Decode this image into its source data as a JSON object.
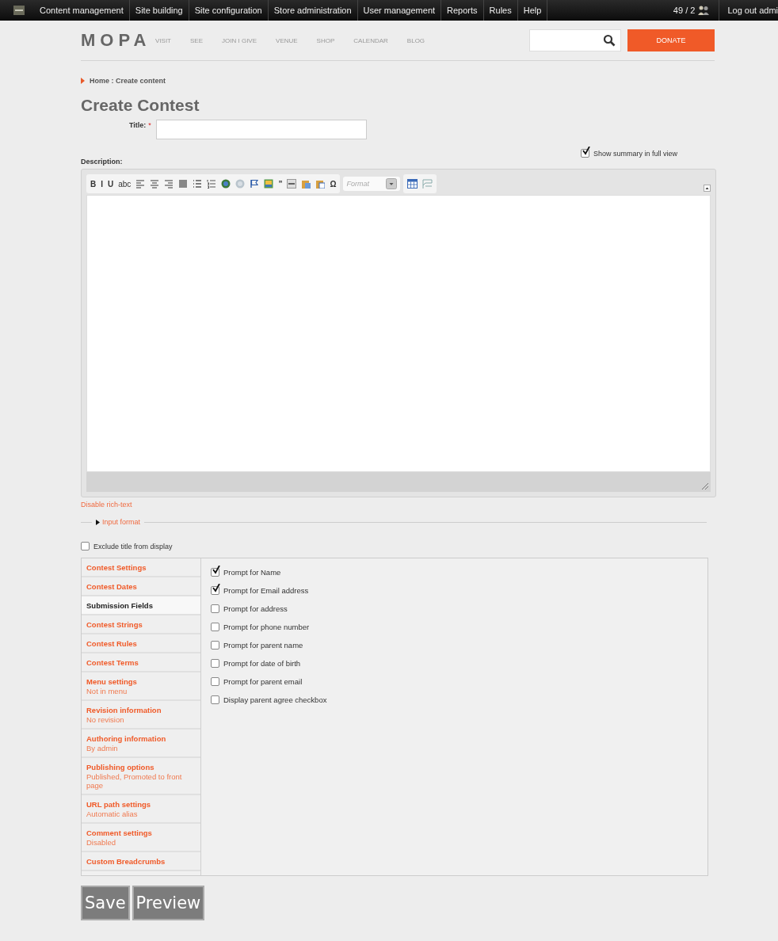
{
  "admin_bar": {
    "menu": [
      "Content management",
      "Site building",
      "Site configuration",
      "Store administration",
      "User management",
      "Reports",
      "Rules",
      "Help"
    ],
    "users_count": "49 / 2",
    "logout": "Log out admi"
  },
  "header": {
    "logo": "MOPA",
    "nav": [
      "VISIT",
      "SEE",
      "JOIN I GIVE",
      "VENUE",
      "SHOP",
      "CALENDAR",
      "BLOG"
    ],
    "donate": "DONATE"
  },
  "breadcrumb": "Home : Create content",
  "page_title": "Create Contest",
  "title_field": {
    "label": "Title:",
    "required_mark": "*"
  },
  "show_summary": {
    "label": "Show summary in full view",
    "checked": true
  },
  "description_label": "Description:",
  "toolbar": [
    {
      "kind": "text",
      "label": "B"
    },
    {
      "kind": "text",
      "label": "I"
    },
    {
      "kind": "text",
      "label": "U"
    },
    {
      "kind": "text",
      "label": "abc"
    },
    {
      "kind": "align-left"
    },
    {
      "kind": "align-center"
    },
    {
      "kind": "align-right"
    },
    {
      "kind": "justify"
    },
    {
      "kind": "bullet-list"
    },
    {
      "kind": "numbered-list"
    },
    {
      "kind": "link"
    },
    {
      "kind": "unlink"
    },
    {
      "kind": "flag"
    },
    {
      "kind": "image"
    },
    {
      "kind": "text",
      "label": "”"
    },
    {
      "kind": "rule"
    },
    {
      "kind": "paste"
    },
    {
      "kind": "paste-word"
    },
    {
      "kind": "text",
      "label": "Ω"
    }
  ],
  "format_select": {
    "placeholder": "Format"
  },
  "toolbar_extra": [
    {
      "kind": "table"
    },
    {
      "kind": "rows"
    }
  ],
  "disable_rich_text": "Disable rich-text",
  "input_format": {
    "label": "Input format",
    "expanded": false
  },
  "exclude_title": {
    "label": "Exclude title from display",
    "checked": false
  },
  "vertical_tabs": [
    {
      "title": "Contest Settings",
      "selected": false
    },
    {
      "title": "Contest Dates",
      "selected": false
    },
    {
      "title": "Submission Fields",
      "selected": true
    },
    {
      "title": "Contest Strings",
      "selected": false
    },
    {
      "title": "Contest Rules",
      "selected": false
    },
    {
      "title": "Contest Terms",
      "selected": false
    },
    {
      "title": "Menu settings",
      "summary": "Not in menu",
      "selected": false
    },
    {
      "title": "Revision information",
      "summary": "No revision",
      "selected": false
    },
    {
      "title": "Authoring information",
      "summary": "By admin",
      "selected": false
    },
    {
      "title": "Publishing options",
      "summary": "Published, Promoted to front page",
      "selected": false
    },
    {
      "title": "URL path settings",
      "summary": "Automatic alias",
      "selected": false
    },
    {
      "title": "Comment settings",
      "summary": "Disabled",
      "selected": false
    },
    {
      "title": "Custom Breadcrumbs",
      "selected": false
    }
  ],
  "submission_fields": [
    {
      "label": "Prompt for Name",
      "checked": true
    },
    {
      "label": "Prompt for Email address",
      "checked": true
    },
    {
      "label": "Prompt for address",
      "checked": false
    },
    {
      "label": "Prompt for phone number",
      "checked": false
    },
    {
      "label": "Prompt for parent name",
      "checked": false
    },
    {
      "label": "Prompt for date of birth",
      "checked": false
    },
    {
      "label": "Prompt for parent email",
      "checked": false
    },
    {
      "label": "Display parent agree checkbox",
      "checked": false
    }
  ],
  "buttons": [
    "Save",
    "Preview"
  ]
}
